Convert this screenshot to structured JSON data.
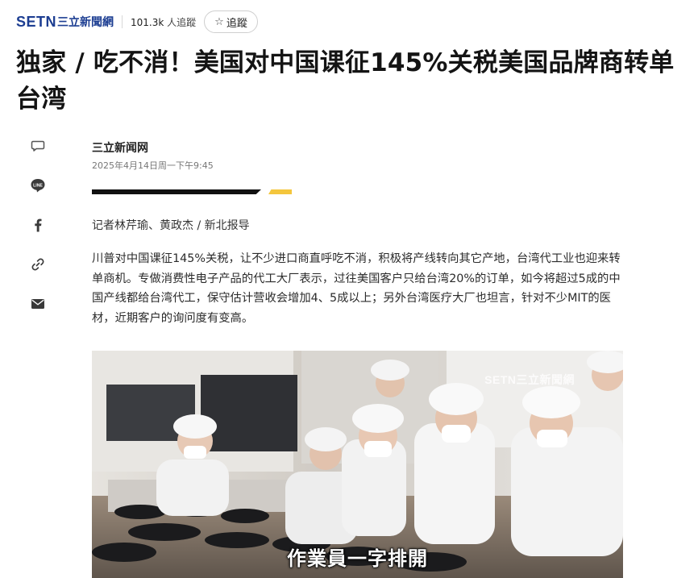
{
  "header": {
    "logo_mark": "SETN",
    "logo_text": "三立新聞網",
    "followers_count": "101.3k",
    "followers_label": "人追蹤",
    "follow_label": "追蹤",
    "brand_color": "#1d3e92"
  },
  "article": {
    "title": "独家 / 吃不消！美国对中国课征145%关税美国品牌商转单台湾",
    "source": "三立新闻网",
    "date": "2025年4月14日周一下午9:45",
    "reporter": "记者林芹瑜、黄政杰 / 新北报导",
    "body": "川普对中国课征145%关税，让不少进口商直呼吃不消，积极将产线转向其它产地，台湾代工业也迎来转单商机。专做消费性电子产品的代工大厂表示，过往美国客户只给台湾20%的订单，如今将超过5成的中国产线都给台湾代工，保守估计营收会增加4、5成以上；另外台湾医疗大厂也坦言，针对不少MIT的医材，近期客户的询问度有变高。",
    "accent_color": "#f4c63d"
  },
  "share": {
    "icons": [
      "comment-icon",
      "line-icon",
      "facebook-icon",
      "link-icon",
      "mail-icon"
    ],
    "line_label": "LINE"
  },
  "photo": {
    "watermark": "SETN三立新聞網",
    "caption": "作業員一字排開"
  }
}
